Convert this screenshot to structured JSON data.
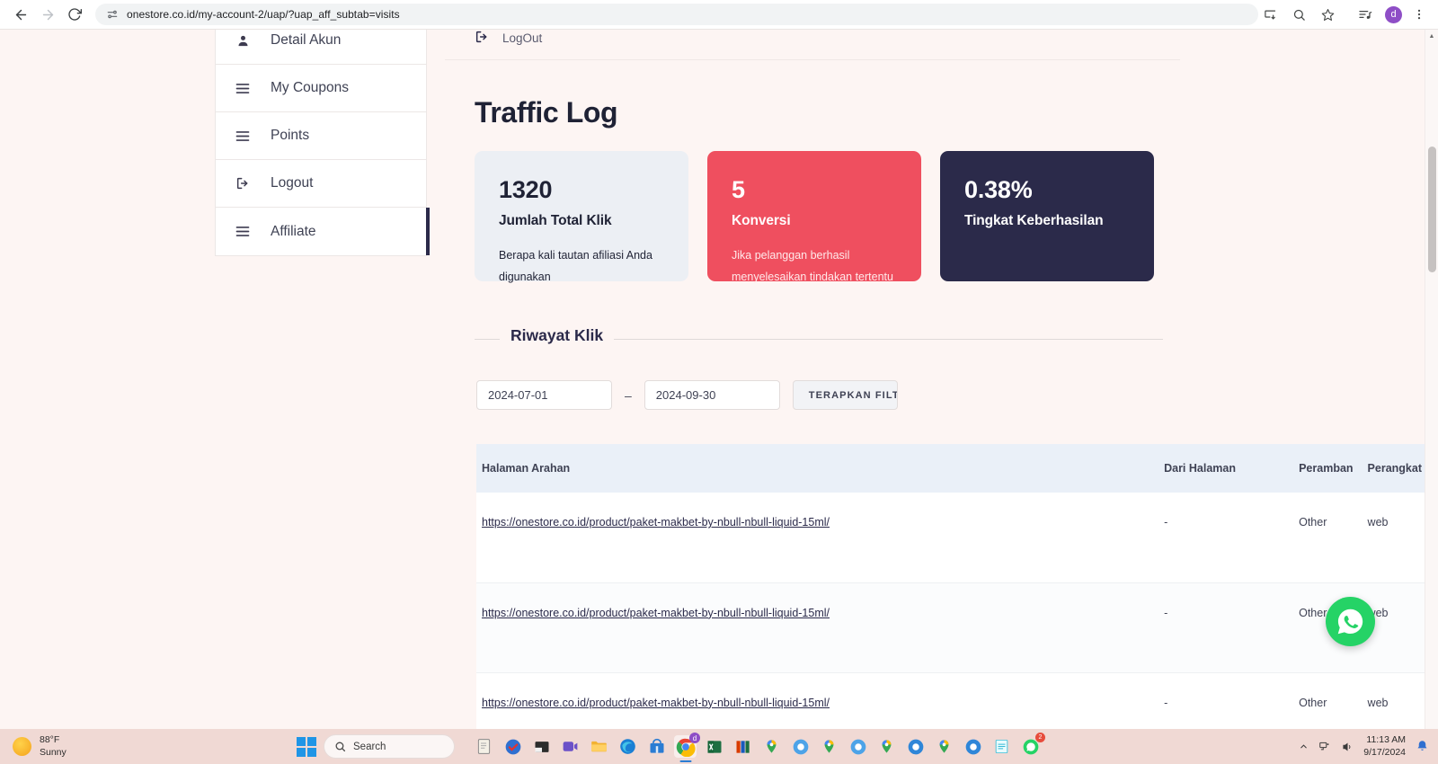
{
  "browser": {
    "url": "onestore.co.id/my-account-2/uap/?uap_aff_subtab=visits",
    "back_label": "Back",
    "forward_label": "Forward",
    "reload_label": "Reload",
    "site_info_label": "View site information",
    "install_label": "Install",
    "zoom_label": "Zoom",
    "bookmark_label": "Bookmark this tab",
    "media_label": "Media controls",
    "profile_initial": "d"
  },
  "account_nav": {
    "items": [
      {
        "label": "Detail Akun",
        "icon": "user-icon",
        "active": false
      },
      {
        "label": "My Coupons",
        "icon": "menu-icon",
        "active": false
      },
      {
        "label": "Points",
        "icon": "menu-icon",
        "active": false
      },
      {
        "label": "Logout",
        "icon": "logout-icon",
        "active": false
      },
      {
        "label": "Affiliate",
        "icon": "menu-icon",
        "active": true
      }
    ]
  },
  "main": {
    "logout_link": "LogOut",
    "title": "Traffic Log",
    "stats": [
      {
        "value": "1320",
        "label": "Jumlah Total Klik",
        "desc": "Berapa kali tautan afiliasi Anda digunakan",
        "theme": "gray",
        "color": "#eceff4"
      },
      {
        "value": "5",
        "label": "Konversi",
        "desc": "Jika pelanggan berhasil menyelesaikan tindakan tertentu",
        "theme": "red",
        "color": "#ef4f5f"
      },
      {
        "value": "0.38%",
        "label": "Tingkat Keberhasilan",
        "desc": "",
        "theme": "navy",
        "color": "#2b2a4a"
      }
    ],
    "history": {
      "legend": "Riwayat Klik",
      "date_from": "2024-07-01",
      "date_to": "2024-09-30",
      "date_separator": "–",
      "apply_button": "TERAPKAN FILTER"
    },
    "table": {
      "columns": [
        "Halaman Arahan",
        "Dari Halaman",
        "Peramban",
        "Perangkat"
      ],
      "rows": [
        {
          "landing_page": "https://onestore.co.id/product/paket-makbet-by-nbull-nbull-liquid-15ml/",
          "from_page": "-",
          "browser": "Other",
          "device": "web"
        },
        {
          "landing_page": "https://onestore.co.id/product/paket-makbet-by-nbull-nbull-liquid-15ml/",
          "from_page": "-",
          "browser": "Other",
          "device": "web"
        },
        {
          "landing_page": "https://onestore.co.id/product/paket-makbet-by-nbull-nbull-liquid-15ml/",
          "from_page": "-",
          "browser": "Other",
          "device": "web"
        }
      ]
    },
    "whatsapp_label": "WhatsApp"
  },
  "taskbar": {
    "weather_temp": "88°F",
    "weather_cond": "Sunny",
    "search_placeholder": "Search",
    "time": "11:13 AM",
    "date": "9/17/2024",
    "start_label": "Start",
    "notification_badge": "2"
  }
}
